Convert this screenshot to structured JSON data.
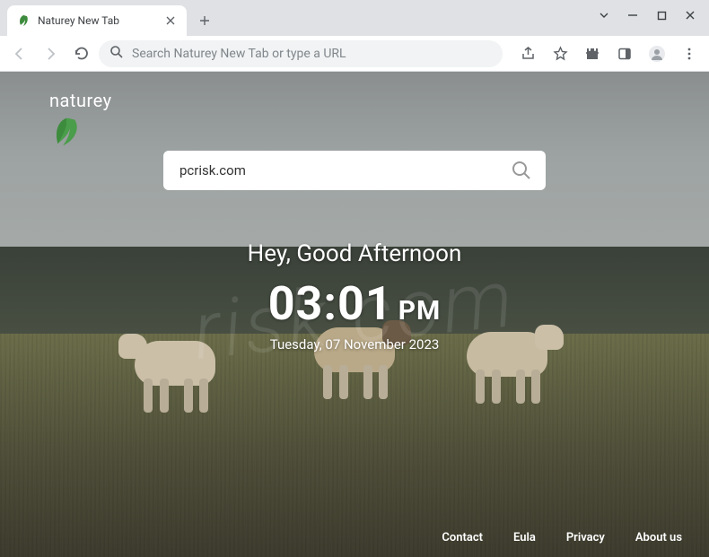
{
  "titlebar": {
    "tab_title": "Naturey New Tab"
  },
  "toolbar": {
    "omnibox_placeholder": "Search Naturey New Tab or type a URL"
  },
  "logo": {
    "text": "naturey"
  },
  "search": {
    "value": "pcrisk.com"
  },
  "greeting": {
    "text": "Hey, Good Afternoon",
    "time": "03:01",
    "ampm": "PM",
    "date": "Tuesday, 07 November 2023"
  },
  "footer": {
    "links": [
      "Contact",
      "Eula",
      "Privacy",
      "About us"
    ]
  },
  "watermark": "risk.com"
}
